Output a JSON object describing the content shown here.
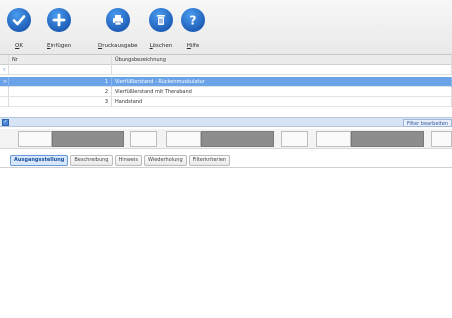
{
  "toolbar": {
    "buttons": [
      {
        "hot": "O",
        "rest": "K",
        "icon": "check-icon"
      },
      {
        "hot": "E",
        "rest": "infügen",
        "icon": "plus-icon"
      },
      {
        "hot": "D",
        "rest": "ruckausgabe",
        "icon": "printer-icon"
      },
      {
        "hot": "L",
        "rest": "öschen",
        "icon": "trash-icon"
      },
      {
        "hot": "H",
        "rest": "ilfe",
        "icon": "help-icon"
      }
    ]
  },
  "grid": {
    "headers": {
      "nr": "Nr",
      "name": "Übungsbezeichnung"
    },
    "filter_indicator": "▿",
    "current_indicator": ">",
    "rows": [
      {
        "nr": "1",
        "name": "Vierfüßlerstand - Rückenmuskulatur",
        "selected": true
      },
      {
        "nr": "2",
        "name": "Vierfüßlerstand mit Theraband",
        "selected": false
      },
      {
        "nr": "3",
        "name": "Handstand",
        "selected": false
      }
    ]
  },
  "filter_bar": {
    "checkbox": "✓",
    "edit_label": "Filter bearbeiten"
  },
  "tabs": [
    {
      "label": "Ausgangsstellung",
      "active": true
    },
    {
      "label": "Beschreibung",
      "active": false
    },
    {
      "label": "Hinweis",
      "active": false
    },
    {
      "label": "Wiederholung",
      "active": false
    },
    {
      "label": "Filterkriterien",
      "active": false
    }
  ],
  "colors": {
    "accent": "#1f5fb8",
    "selection": "#6aa3e8"
  }
}
